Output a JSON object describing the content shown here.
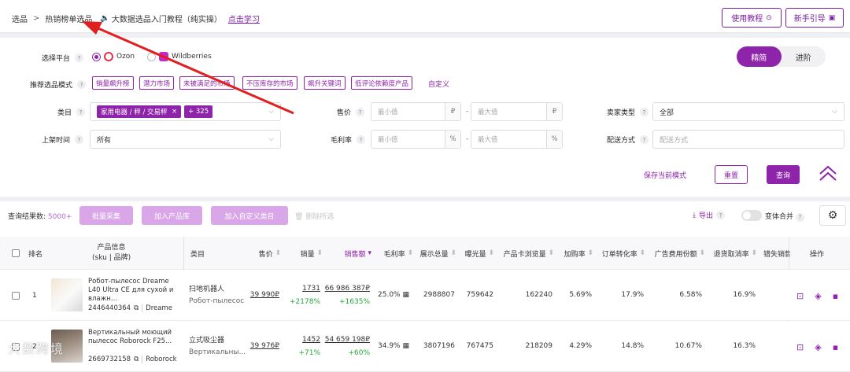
{
  "breadcrumb": {
    "root": "选品",
    "sep": ">",
    "current": "热销榜单选品",
    "tutorial": "大数据选品入门教程（纯实操）",
    "learn": "点击学习"
  },
  "topbar": {
    "tutorial_btn": "使用教程",
    "guide_btn": "新手引导"
  },
  "filters": {
    "platform_label": "选择平台",
    "platforms": [
      "Ozon",
      "Wildberries"
    ],
    "selected_platform": "Ozon",
    "mode_toggle": [
      "精简",
      "进阶"
    ],
    "mode_active": "精简",
    "recommend_label": "推荐选品模式",
    "recommend_chips": [
      "销量飙升榜",
      "潜力市场",
      "未被满足的市场",
      "不压库存的市场",
      "飙升关键词",
      "低评论依赖度产品"
    ],
    "custom": "自定义",
    "category_label": "类目",
    "category_tag": "家用电器 / 秤 / 交易秤",
    "category_more": "+ 325",
    "price_label": "售价",
    "price_min": "最小值",
    "price_max": "最大值",
    "price_unit": "₽",
    "seller_label": "卖家类型",
    "seller_value": "全部",
    "listed_label": "上架时间",
    "listed_value": "所有",
    "margin_label": "毛利率",
    "margin_min": "最小值",
    "margin_max": "最大值",
    "margin_unit": "%",
    "delivery_label": "配送方式",
    "delivery_placeholder": "配送方式",
    "save_mode": "保存当前模式",
    "reset": "重置",
    "query": "查询"
  },
  "results": {
    "count_label": "查询结果数:",
    "count": "5000+",
    "batch": "批量采集",
    "add_product": "加入产品库",
    "add_category": "加入自定义类目",
    "delete": "删除所选",
    "export": "导出",
    "variant_merge": "变体合并"
  },
  "table": {
    "headers": {
      "rank": "排名",
      "product": "产品信息",
      "product_sub": "(sku | 品牌)",
      "category": "类目",
      "price": "售价",
      "sales": "销量",
      "revenue": "销售额",
      "margin": "毛利率",
      "impressions": "展示总量",
      "exposure": "曝光量",
      "card_views": "产品卡浏览量",
      "cart_rate": "加购率",
      "conv_rate": "订单转化率",
      "ad_share": "广告费用份额",
      "return_rate": "退货取消率",
      "missed": "错失销售",
      "ops": "操作"
    },
    "rows": [
      {
        "rank": "1",
        "name": "Робот-пылесос Dreame L40 Ultra CE для сухой и влажн...",
        "sku": "2446440364",
        "brand": "Dreame",
        "category": "扫地机器人",
        "category_ru": "Робот-пылесос",
        "price": "39 990₽",
        "sales": "1731",
        "sales_growth": "+2178%",
        "revenue": "66 986 387₽",
        "revenue_growth": "+1635%",
        "margin": "25.0%",
        "impressions": "2988807",
        "exposure": "759642",
        "card_views": "162240",
        "cart_rate": "5.69%",
        "conv_rate": "17.9%",
        "ad_share": "6.58%",
        "return_rate": "16.9%"
      },
      {
        "rank": "2",
        "name": "Вертикальный моющий пылесос Roborock F25...",
        "sku": "2669732158",
        "brand": "Roborock",
        "category": "立式吸尘器",
        "category_ru": "Вертикальны...",
        "price": "39 976₽",
        "sales": "1452",
        "sales_growth": "+71%",
        "revenue": "54 659 198₽",
        "revenue_growth": "+60%",
        "margin": "34.9%",
        "impressions": "3807196",
        "exposure": "767475",
        "card_views": "218209",
        "cart_rate": "4.29%",
        "conv_rate": "14.8%",
        "ad_share": "10.67%",
        "return_rate": "16.3%"
      }
    ]
  },
  "watermark": "大数跨境",
  "colors": {
    "accent": "#8e24aa",
    "arrow": "#e02020",
    "growth": "#22a83a"
  }
}
